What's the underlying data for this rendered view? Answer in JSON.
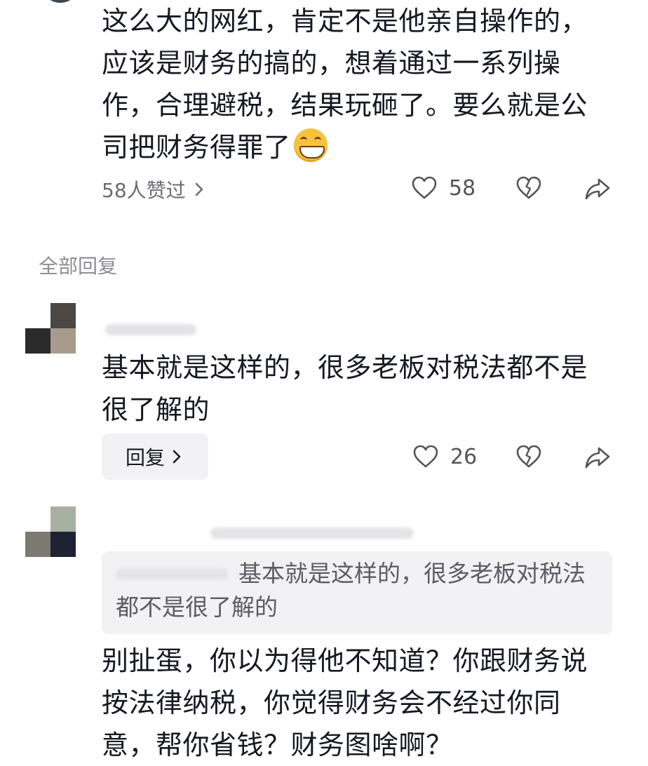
{
  "main_comment": {
    "text": "这么大的网红，肯定不是他亲自操作的，应该是财务的搞的，想着通过一系列操作，合理避税，结果玩砸了。要么就是公司把财务得罪了",
    "emoji": "grinning-face",
    "likes_link": "58人赞过",
    "like_count": "58"
  },
  "section_label": "全部回复",
  "replies": [
    {
      "text": "基本就是这样的，很多老板对税法都不是很了解的",
      "reply_button": "回复",
      "like_count": "26"
    },
    {
      "quoted_text": "基本就是这样的，很多老板对税法都不是很了解的",
      "text": "别扯蛋，你以为得他不知道？你跟财务说按法律纳税，你觉得财务会不经过你同意，帮你省钱？财务图啥啊？"
    }
  ],
  "icons": {
    "like": "heart-outline-icon",
    "dislike": "broken-heart-icon",
    "share": "share-arrow-icon",
    "chevron": "chevron-right-icon"
  },
  "colors": {
    "text_primary": "#161823",
    "text_secondary": "#6b6b73",
    "quote_bg": "#f2f2f4"
  }
}
